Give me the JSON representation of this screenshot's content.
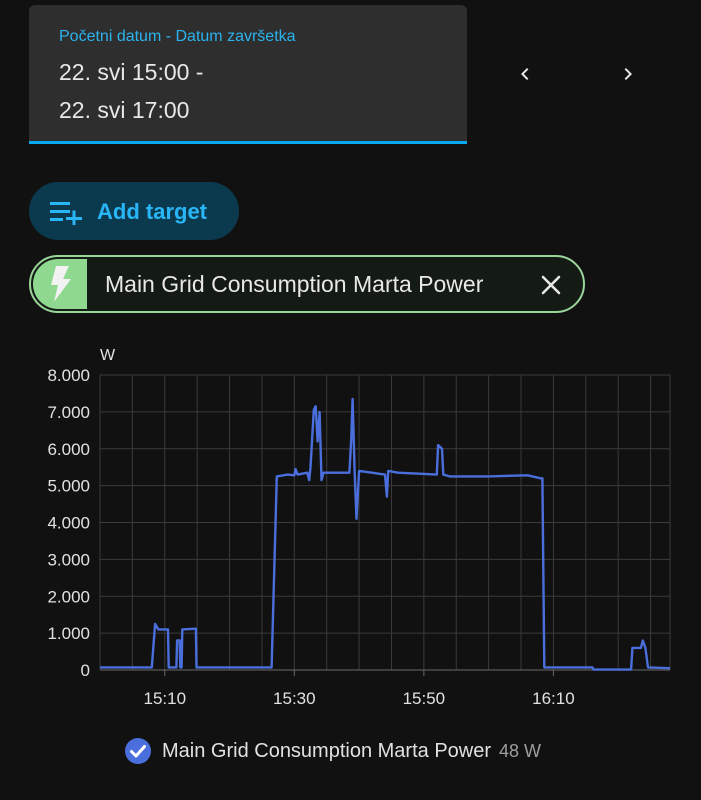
{
  "date_picker": {
    "label": "Početni datum - Datum završetka",
    "line1": "22. svi 15:00 -",
    "line2": "22. svi 17:00",
    "prev_icon": "chevron-left-icon",
    "next_icon": "chevron-right-icon"
  },
  "add_target": {
    "label": "Add target",
    "icon": "playlist-plus-icon"
  },
  "target_chip": {
    "label": "Main Grid Consumption Marta Power",
    "icon": "flash-icon",
    "remove_icon": "close-icon"
  },
  "colors": {
    "accent": "#03a9f4",
    "series": "#4a6fdc",
    "chip_border": "#9ad59a",
    "chip_icon_bg": "#8fd88f"
  },
  "chart_data": {
    "type": "line",
    "ylabel": "W",
    "ylim": [
      0,
      8000
    ],
    "yticks": [
      {
        "value": 0,
        "label": "0"
      },
      {
        "value": 1000,
        "label": "1.000"
      },
      {
        "value": 2000,
        "label": "2.000"
      },
      {
        "value": 3000,
        "label": "3.000"
      },
      {
        "value": 4000,
        "label": "4.000"
      },
      {
        "value": 5000,
        "label": "5.000"
      },
      {
        "value": 6000,
        "label": "6.000"
      },
      {
        "value": 7000,
        "label": "7.000"
      },
      {
        "value": 8000,
        "label": "8.000"
      }
    ],
    "xlim": [
      "15:00",
      "16:28"
    ],
    "xticks": [
      "15:10",
      "15:30",
      "15:50",
      "16:10"
    ],
    "grid": true,
    "series": [
      {
        "name": "Main Grid Consumption Marta Power",
        "current": "48 W",
        "points": [
          [
            "15:00",
            70
          ],
          [
            "15:08",
            70
          ],
          [
            "15:08.5",
            1250
          ],
          [
            "15:09",
            1100
          ],
          [
            "15:10",
            1100
          ],
          [
            "15:10.5",
            1100
          ],
          [
            "15:10.6",
            70
          ],
          [
            "15:11.8",
            70
          ],
          [
            "15:11.9",
            800
          ],
          [
            "15:12.3",
            800
          ],
          [
            "15:12.4",
            70
          ],
          [
            "15:12.6",
            70
          ],
          [
            "15:12.7",
            1100
          ],
          [
            "15:14.8",
            1120
          ],
          [
            "15:14.9",
            70
          ],
          [
            "15:26.5",
            70
          ],
          [
            "15:27.3",
            5250
          ],
          [
            "15:29",
            5300
          ],
          [
            "15:30",
            5280
          ],
          [
            "15:30.2",
            5450
          ],
          [
            "15:30.5",
            5300
          ],
          [
            "15:32",
            5350
          ],
          [
            "15:32.3",
            5150
          ],
          [
            "15:32.5",
            5500
          ],
          [
            "15:33",
            7050
          ],
          [
            "15:33.3",
            7150
          ],
          [
            "15:33.6",
            6200
          ],
          [
            "15:33.9",
            7000
          ],
          [
            "15:34.2",
            5150
          ],
          [
            "15:34.5",
            5350
          ],
          [
            "15:38.5",
            5350
          ],
          [
            "15:38.8",
            6300
          ],
          [
            "15:39",
            7350
          ],
          [
            "15:39.3",
            5400
          ],
          [
            "15:39.6",
            4100
          ],
          [
            "15:40",
            5400
          ],
          [
            "15:42",
            5350
          ],
          [
            "15:44",
            5300
          ],
          [
            "15:44.3",
            4700
          ],
          [
            "15:44.5",
            5400
          ],
          [
            "15:46",
            5350
          ],
          [
            "15:52",
            5300
          ],
          [
            "15:52.2",
            6100
          ],
          [
            "15:52.8",
            6000
          ],
          [
            "15:53",
            5300
          ],
          [
            "15:54",
            5250
          ],
          [
            "16:00",
            5250
          ],
          [
            "16:06",
            5280
          ],
          [
            "16:08",
            5200
          ],
          [
            "16:08.3",
            5200
          ],
          [
            "16:08.6",
            70
          ],
          [
            "16:16",
            70
          ],
          [
            "16:16.2",
            10
          ],
          [
            "16:22",
            10
          ],
          [
            "16:22.2",
            600
          ],
          [
            "16:23.5",
            600
          ],
          [
            "16:23.8",
            800
          ],
          [
            "16:24.2",
            600
          ],
          [
            "16:24.6",
            70
          ],
          [
            "16:28",
            48
          ]
        ]
      }
    ]
  }
}
